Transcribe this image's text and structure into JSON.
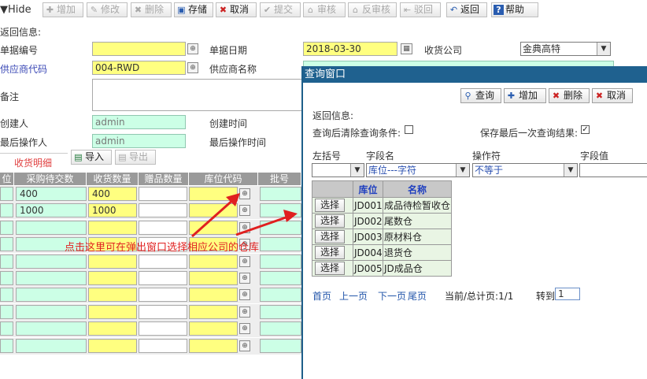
{
  "toolbar": {
    "hide": "Hide",
    "add": "增加",
    "edit": "修改",
    "delete": "删除",
    "save": "存储",
    "cancel": "取消",
    "submit": "提交",
    "audit": "审核",
    "unaudit": "反审核",
    "reject": "驳回",
    "back": "返回",
    "help": "帮助"
  },
  "form": {
    "return_info": "返回信息:",
    "doc_no_label": "单据编号",
    "doc_no_value": "",
    "doc_date_label": "单据日期",
    "doc_date_value": "2018-03-30",
    "receiver_label": "收货公司",
    "receiver_value": "金典高特",
    "supplier_code_label": "供应商代码",
    "supplier_code_value": "004-RWD",
    "supplier_name_label": "供应商名称",
    "remark_label": "备注",
    "creator_label": "创建人",
    "creator_value": "admin",
    "created_time_label": "创建时间",
    "last_operator_label": "最后操作人",
    "last_operator_value": "admin",
    "last_operated_time_label": "最后操作时间"
  },
  "detail": {
    "tab_label": "收货明细",
    "import": "导入",
    "export": "导出",
    "headers": [
      "位",
      "采购待交数",
      "收货数量",
      "赠品数量",
      "库位代码",
      "批号"
    ],
    "rows": [
      {
        "pending": "400",
        "received": "400"
      },
      {
        "pending": "1000",
        "received": "1000"
      },
      {
        "pending": "",
        "received": ""
      },
      {
        "pending": "",
        "received": ""
      },
      {
        "pending": "",
        "received": ""
      },
      {
        "pending": "",
        "received": ""
      },
      {
        "pending": "",
        "received": ""
      },
      {
        "pending": "",
        "received": ""
      },
      {
        "pending": "",
        "received": ""
      },
      {
        "pending": "",
        "received": ""
      }
    ]
  },
  "annotation": "点击这里可在弹出窗口选择相应公司的仓库",
  "dialog": {
    "title": "查询窗口",
    "query": "查询",
    "add": "增加",
    "delete": "删除",
    "cancel": "取消",
    "return_info": "返回信息:",
    "clear_after_query": "查询后清除查询条件:",
    "save_last_result": "保存最后一次查询结果:",
    "left_paren_label": "左括号",
    "field_label": "字段名",
    "operator_label": "操作符",
    "value_label": "字段值",
    "field_value": "库位---字符",
    "operator_value": "不等于",
    "value_input": "",
    "col_location": "库位",
    "col_name": "名称",
    "select_label": "选择",
    "rows": [
      {
        "code": "JD001",
        "name": "成品待检暂收仓"
      },
      {
        "code": "JD002",
        "name": "尾数仓"
      },
      {
        "code": "JD003",
        "name": "原材料仓"
      },
      {
        "code": "JD004",
        "name": "退货仓"
      },
      {
        "code": "JD005",
        "name": "JD成品仓"
      }
    ],
    "pager": {
      "first": "首页",
      "prev": "上一页",
      "next": "下一页",
      "last": "尾页",
      "info": "当前/总计页:1/1",
      "goto": "转到",
      "page": "1"
    }
  }
}
